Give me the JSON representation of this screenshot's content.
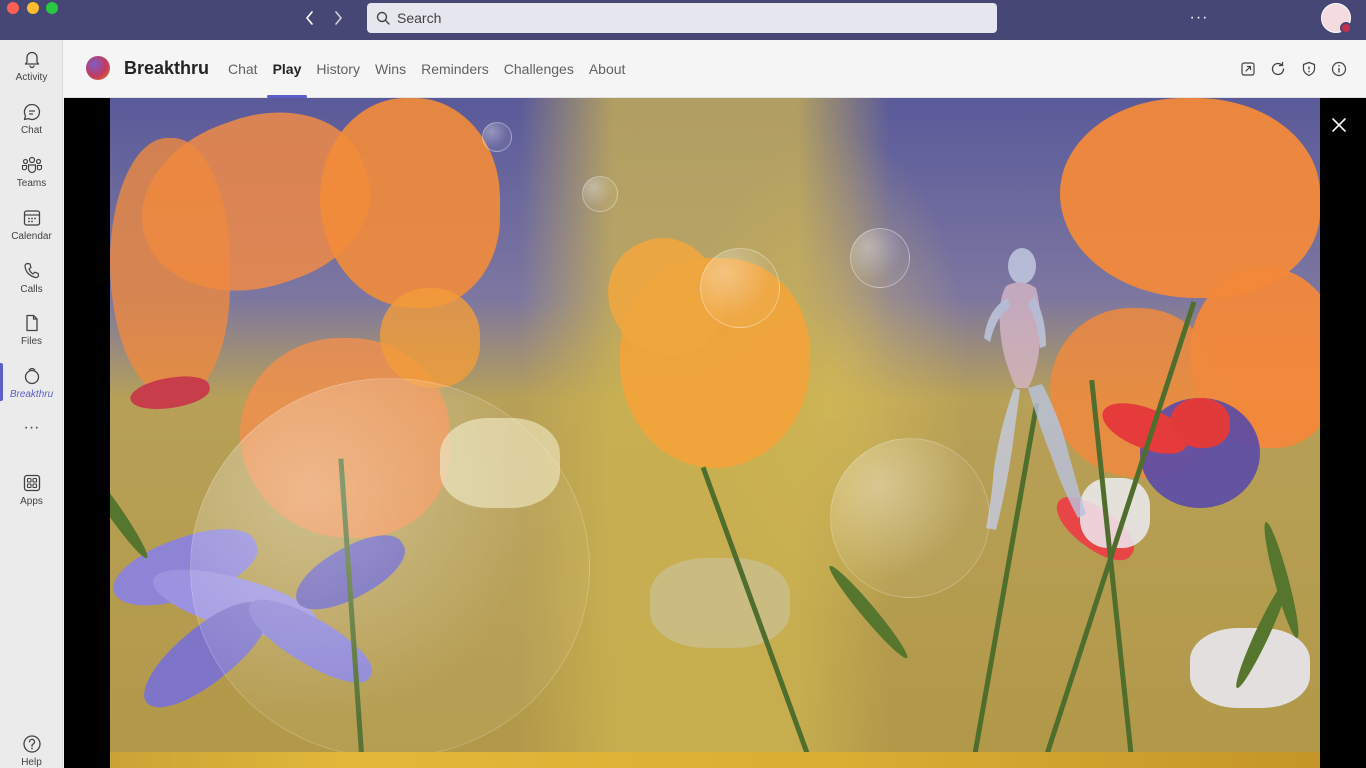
{
  "titlebar": {
    "search_placeholder": "Search",
    "more_label": "···"
  },
  "rail": {
    "items": [
      {
        "label": "Activity",
        "icon": "bell-icon"
      },
      {
        "label": "Chat",
        "icon": "chat-icon"
      },
      {
        "label": "Teams",
        "icon": "teams-icon"
      },
      {
        "label": "Calendar",
        "icon": "calendar-icon"
      },
      {
        "label": "Calls",
        "icon": "phone-icon"
      },
      {
        "label": "Files",
        "icon": "file-icon"
      },
      {
        "label": "Breakthru",
        "icon": "breakthru-icon",
        "active": true
      },
      {
        "label": "",
        "icon": "more-icon"
      },
      {
        "label": "Apps",
        "icon": "apps-icon"
      },
      {
        "label": "Help",
        "icon": "help-icon"
      }
    ],
    "more_glyph": "···"
  },
  "app": {
    "title": "Breakthru",
    "tabs": [
      {
        "label": "Chat"
      },
      {
        "label": "Play",
        "active": true
      },
      {
        "label": "History"
      },
      {
        "label": "Wins"
      },
      {
        "label": "Reminders"
      },
      {
        "label": "Challenges"
      },
      {
        "label": "About"
      }
    ],
    "header_icons": [
      "popout-icon",
      "refresh-icon",
      "shield-icon",
      "info-icon"
    ]
  },
  "stage": {
    "close_icon": "close-icon"
  },
  "colors": {
    "titlebar": "#464775",
    "accent": "#5b5fc7",
    "rail": "#ebebeb",
    "header": "#f5f5f5"
  }
}
